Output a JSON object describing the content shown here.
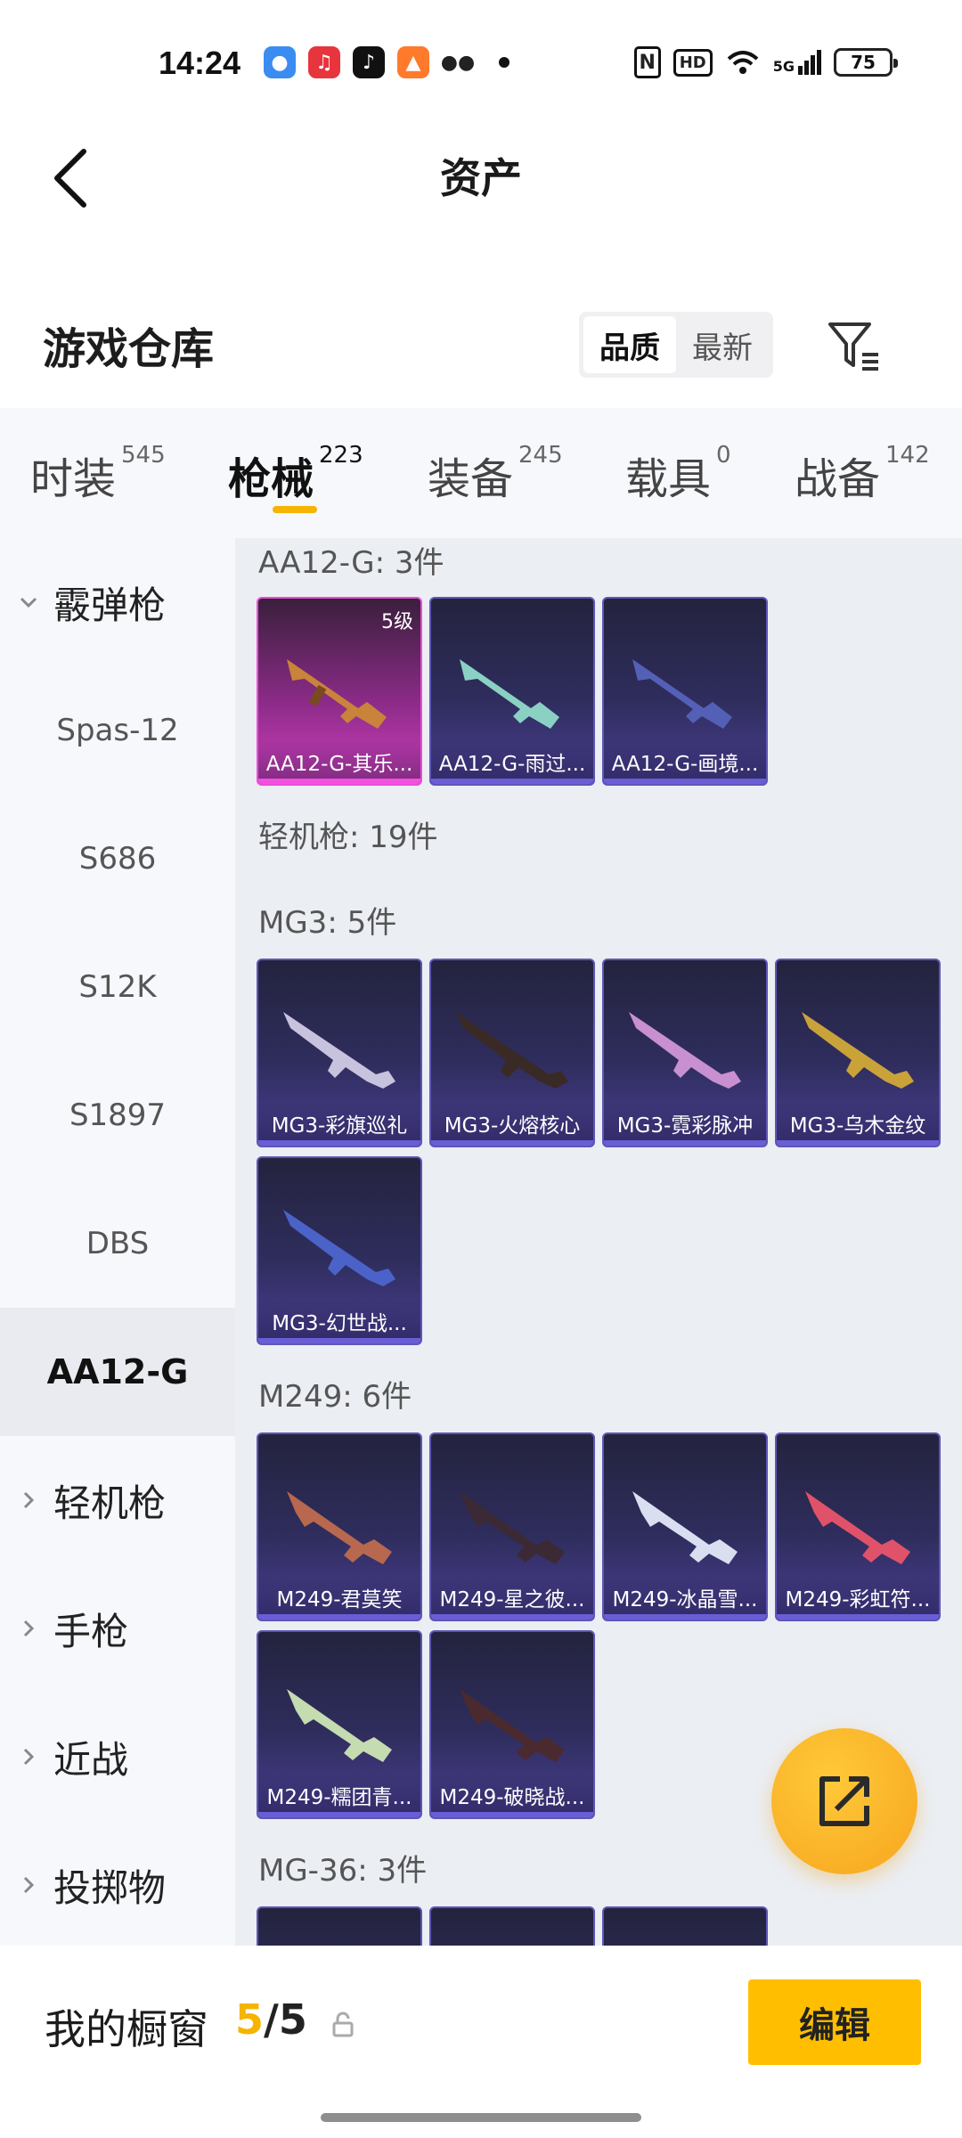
{
  "status_bar": {
    "time": "14:24",
    "signal_label": "5G",
    "hd_label": "HD",
    "battery": "75",
    "app_icons": [
      "app-blue-icon",
      "music-icon",
      "tiktok-icon",
      "game-icon",
      "wechat-icon"
    ]
  },
  "header": {
    "title": "资产"
  },
  "warehouse": {
    "title": "游戏仓库",
    "sort_options": [
      "品质",
      "最新"
    ],
    "sort_selected": "品质"
  },
  "tabs": [
    {
      "label": "时装",
      "count": "545"
    },
    {
      "label": "枪械",
      "count": "223",
      "active": true
    },
    {
      "label": "装备",
      "count": "245"
    },
    {
      "label": "载具",
      "count": "0"
    },
    {
      "label": "战备",
      "count": "142"
    }
  ],
  "sidebar": {
    "items": [
      {
        "label": "霰弹枪",
        "type": "group",
        "expanded": true
      },
      {
        "label": "Spas-12",
        "type": "sub"
      },
      {
        "label": "S686",
        "type": "sub"
      },
      {
        "label": "S12K",
        "type": "sub"
      },
      {
        "label": "S1897",
        "type": "sub"
      },
      {
        "label": "DBS",
        "type": "sub"
      },
      {
        "label": "AA12-G",
        "type": "sub",
        "active": true
      },
      {
        "label": "轻机枪",
        "type": "group"
      },
      {
        "label": "手枪",
        "type": "group"
      },
      {
        "label": "近战",
        "type": "group"
      },
      {
        "label": "投掷物",
        "type": "group"
      }
    ]
  },
  "content": {
    "sections": [
      {
        "label": "AA12-G: 3件",
        "items": [
          {
            "name": "AA12-G-其乐...",
            "level": "5级",
            "rarity": "pink",
            "color": "#c9833b"
          },
          {
            "name": "AA12-G-雨过...",
            "rarity": "purple",
            "color": "#8ad1c4"
          },
          {
            "name": "AA12-G-画境...",
            "rarity": "purple",
            "color": "#5360b6"
          }
        ]
      },
      {
        "label": "轻机枪: 19件",
        "items": []
      },
      {
        "label": "MG3: 5件",
        "items": [
          {
            "name": "MG3-彩旗巡礼",
            "rarity": "purple",
            "color": "#c7c2dd"
          },
          {
            "name": "MG3-火熔核心",
            "rarity": "purple",
            "color": "#3a2a25"
          },
          {
            "name": "MG3-霓彩脉冲",
            "rarity": "purple",
            "color": "#c890d0"
          },
          {
            "name": "MG3-乌木金纹",
            "rarity": "purple",
            "color": "#caa23a"
          },
          {
            "name": "MG3-幻世战...",
            "rarity": "purple",
            "color": "#4b63c8"
          }
        ]
      },
      {
        "label": "M249: 6件",
        "items": [
          {
            "name": "M249-君莫笑",
            "rarity": "purple",
            "color": "#b8684f"
          },
          {
            "name": "M249-星之彼...",
            "rarity": "purple",
            "color": "#3b2a35"
          },
          {
            "name": "M249-冰晶雪...",
            "rarity": "purple",
            "color": "#d9dff0"
          },
          {
            "name": "M249-彩虹符...",
            "rarity": "purple",
            "color": "#e0526a"
          },
          {
            "name": "M249-糯团青...",
            "rarity": "purple",
            "color": "#c5dbb0"
          },
          {
            "name": "M249-破晓战...",
            "rarity": "purple",
            "color": "#4a2a2e"
          }
        ]
      },
      {
        "label": "MG-36: 3件",
        "items": [
          {
            "name": "",
            "rarity": "purple",
            "color": "#3d3a5a"
          },
          {
            "name": "",
            "rarity": "purple",
            "color": "#3d3a5a"
          },
          {
            "name": "",
            "rarity": "purple",
            "color": "#3d3a5a"
          }
        ]
      }
    ]
  },
  "bottom_bar": {
    "label": "我的橱窗",
    "count_current": "5",
    "count_sep": "/",
    "count_total": "5",
    "edit_label": "编辑"
  },
  "colors": {
    "accent": "#f5b400",
    "fab": "#f7a51d",
    "card_purple": "#4a3f93",
    "card_pink": "#d23fbf"
  }
}
